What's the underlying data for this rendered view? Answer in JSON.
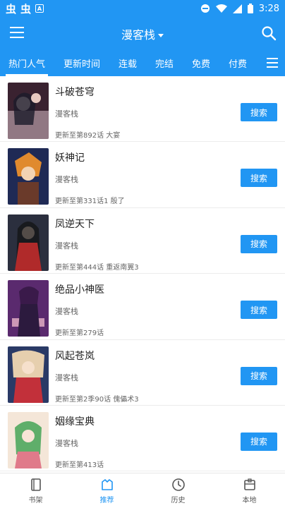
{
  "status_bar": {
    "app_icons": [
      "虫",
      "虫"
    ],
    "a_icon": "A",
    "time": "3:28"
  },
  "app_bar": {
    "title": "漫客栈"
  },
  "tabs": [
    {
      "label": "热门人气",
      "active": true
    },
    {
      "label": "更新时间",
      "active": false
    },
    {
      "label": "连载",
      "active": false
    },
    {
      "label": "完结",
      "active": false
    },
    {
      "label": "免费",
      "active": false
    },
    {
      "label": "付费",
      "active": false
    }
  ],
  "comics": [
    {
      "name": "斗破苍穹",
      "source": "漫客栈",
      "update": "更新至第892话 大宴",
      "button": "搜索",
      "cover_colors": [
        "#3a2230",
        "#d9c0c8"
      ]
    },
    {
      "name": "妖神记",
      "source": "漫客栈",
      "update": "更新至第331话1 殷了",
      "button": "搜索",
      "cover_colors": [
        "#1f2a55",
        "#e08a2e"
      ]
    },
    {
      "name": "凤逆天下",
      "source": "漫客栈",
      "update": "更新至第444话 重返南翼3",
      "button": "搜索",
      "cover_colors": [
        "#2b2f3e",
        "#c8b89a"
      ]
    },
    {
      "name": "绝品小神医",
      "source": "漫客栈",
      "update": "更新至第279话",
      "button": "搜索",
      "cover_colors": [
        "#5a2a6e",
        "#e8b4c8"
      ]
    },
    {
      "name": "风起苍岚",
      "source": "漫客栈",
      "update": "更新至第2季90话 傀儡术3",
      "button": "搜索",
      "cover_colors": [
        "#2a3a66",
        "#e6cfae"
      ]
    },
    {
      "name": "姻缘宝典",
      "source": "漫客栈",
      "update": "更新至第413话",
      "button": "搜索",
      "cover_colors": [
        "#f4e6d8",
        "#5fae6a"
      ]
    }
  ],
  "bottom_nav": [
    {
      "label": "书架",
      "icon": "bookshelf-icon",
      "active": false
    },
    {
      "label": "推荐",
      "icon": "recommend-icon",
      "active": true
    },
    {
      "label": "历史",
      "icon": "clock-icon",
      "active": false
    },
    {
      "label": "本地",
      "icon": "local-storage-icon",
      "active": false
    }
  ],
  "colors": {
    "primary": "#2196F3",
    "text": "#222222",
    "secondary_text": "#666666"
  }
}
